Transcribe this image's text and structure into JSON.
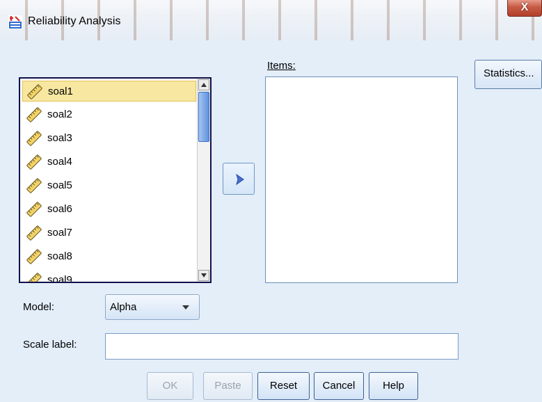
{
  "window": {
    "title": "Reliability Analysis",
    "close_label": "X"
  },
  "source_list": {
    "variables": [
      {
        "name": "soal1",
        "selected": true
      },
      {
        "name": "soal2",
        "selected": false
      },
      {
        "name": "soal3",
        "selected": false
      },
      {
        "name": "soal4",
        "selected": false
      },
      {
        "name": "soal5",
        "selected": false
      },
      {
        "name": "soal6",
        "selected": false
      },
      {
        "name": "soal7",
        "selected": false
      },
      {
        "name": "soal8",
        "selected": false
      },
      {
        "name": "soal9",
        "selected": false
      }
    ],
    "variable_icon": "ruler-scale-icon"
  },
  "items": {
    "label": "Items:",
    "entries": []
  },
  "statistics_label": "Statistics...",
  "model": {
    "label": "Model:",
    "value": "Alpha"
  },
  "scale_label": {
    "label": "Scale label:",
    "value": ""
  },
  "buttons": {
    "ok": "OK",
    "paste": "Paste",
    "reset": "Reset",
    "cancel": "Cancel",
    "help": "Help"
  },
  "colors": {
    "dialog_bg": "#e3eef9",
    "selection": "#f7e7a0",
    "close_red": "#c75a44"
  }
}
